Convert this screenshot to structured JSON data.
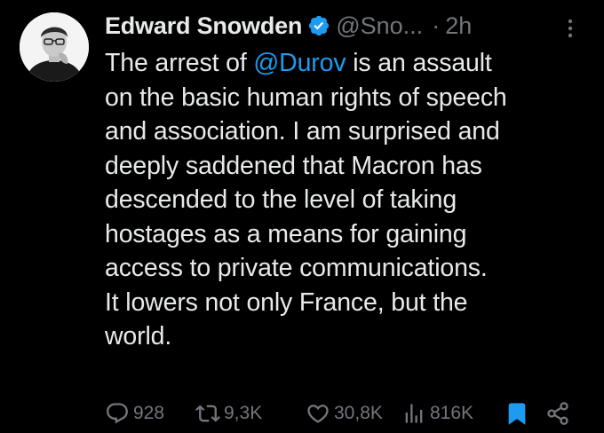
{
  "author": {
    "name": "Edward Snowden",
    "handle": "@Sno...",
    "separator": "·",
    "time": "2h",
    "verified_icon": "verified-badge-icon",
    "verified_color": "#1d9bf0"
  },
  "tweet": {
    "text_before_mention": "The arrest of ",
    "mention": "@Durov",
    "text_after_mention": " is an assault\non the basic human rights of speech\nand association. I am surprised and\ndeeply saddened that Macron has\ndescended to the level of taking\nhostages as a means for gaining\naccess to private communications.\nIt lowers not only France, but the\nworld."
  },
  "actions": {
    "replies": "928",
    "reposts": "9,3K",
    "likes": "30,8K",
    "views": "816K",
    "bookmark_color": "#1d9bf0",
    "icons": [
      "reply-icon",
      "repost-icon",
      "like-icon",
      "views-icon",
      "bookmark-icon",
      "share-icon"
    ]
  },
  "colors": {
    "background": "#000000",
    "text": "#e7e9ea",
    "muted": "#71767b",
    "accent": "#1d9bf0"
  }
}
